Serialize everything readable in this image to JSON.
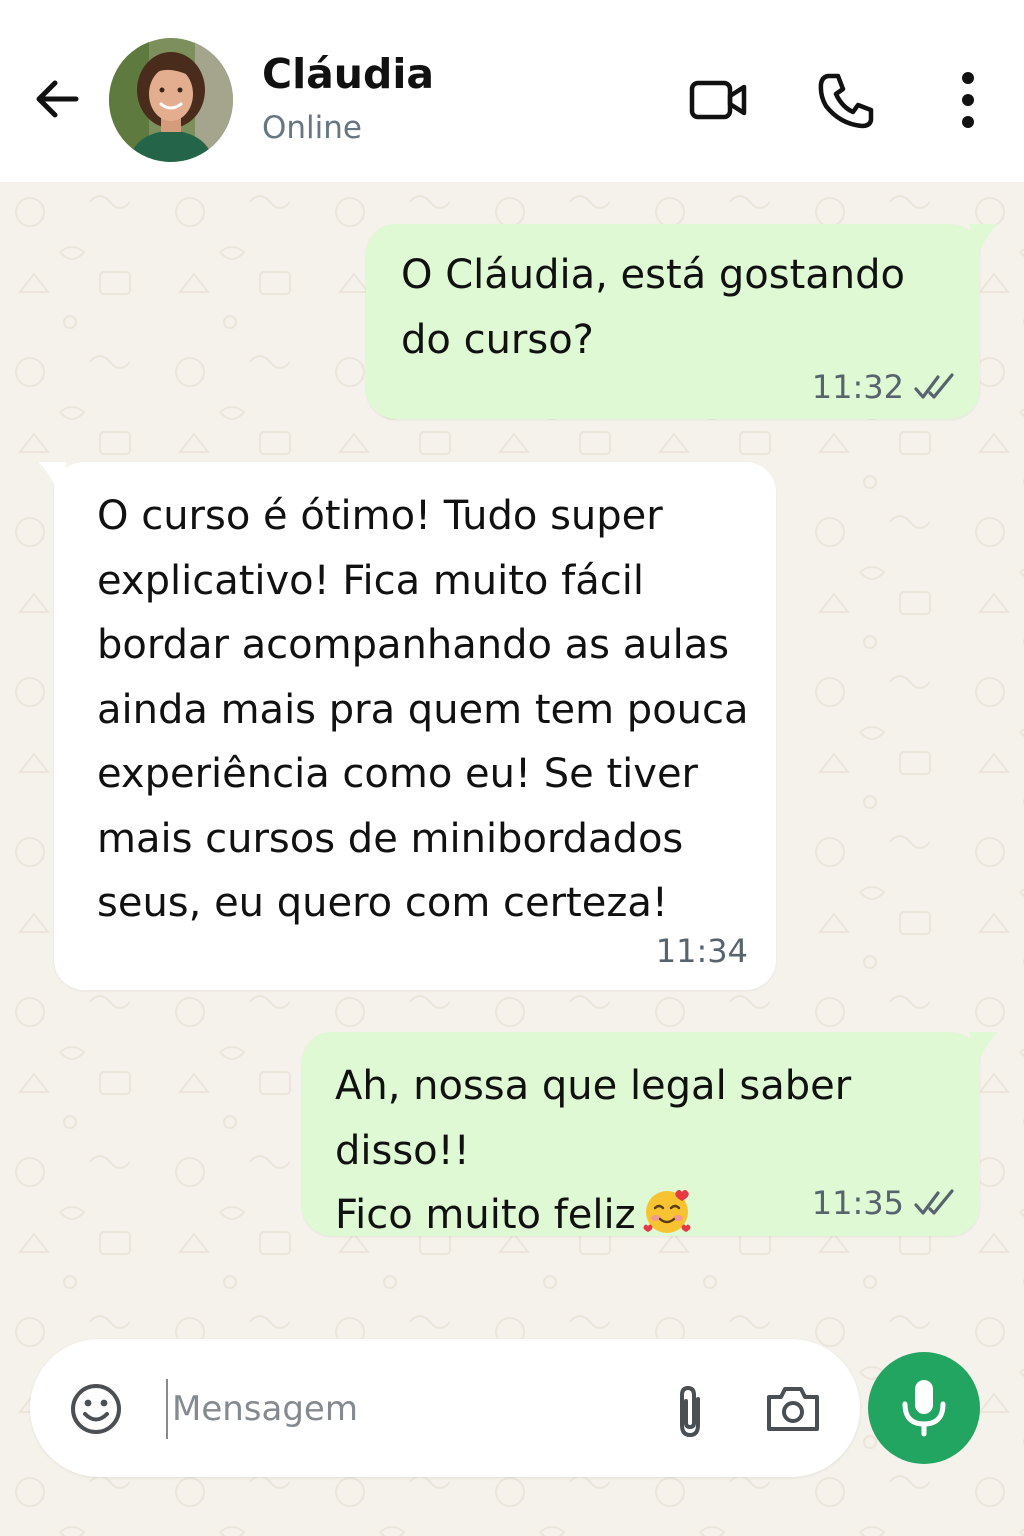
{
  "header": {
    "contact_name": "Cláudia",
    "contact_status": "Online",
    "icons": {
      "back": "arrow-left-icon",
      "video": "video-camera-icon",
      "call": "phone-icon",
      "more": "more-vertical-icon"
    }
  },
  "messages": [
    {
      "direction": "outgoing",
      "text_lines": [
        "O Cláudia, está gostando",
        "do curso?"
      ],
      "time": "11:32",
      "status": "read"
    },
    {
      "direction": "incoming",
      "text_lines": [
        "O curso é ótimo! Tudo super",
        "explicativo! Fica muito fácil",
        "bordar acompanhando as aulas",
        "ainda mais pra quem tem pouca",
        "experiência como eu! Se tiver",
        "mais cursos de minibordados",
        "seus, eu quero com certeza!"
      ],
      "time": "11:34"
    },
    {
      "direction": "outgoing",
      "text_lines": [
        "Ah, nossa que legal saber disso!!",
        "Fico muito feliz"
      ],
      "emoji": "smiling-face-with-hearts",
      "time": "11:35",
      "status": "read"
    }
  ],
  "composer": {
    "placeholder": "Mensagem",
    "value": "",
    "icons": {
      "emoji": "smiley-icon",
      "attach": "paperclip-icon",
      "camera": "camera-icon",
      "mic": "microphone-icon"
    }
  },
  "colors": {
    "outgoing_bubble": "#def9d3",
    "incoming_bubble": "#ffffff",
    "chat_background": "#f5f1eb",
    "mic_button": "#21a561",
    "status_text": "#667781"
  }
}
